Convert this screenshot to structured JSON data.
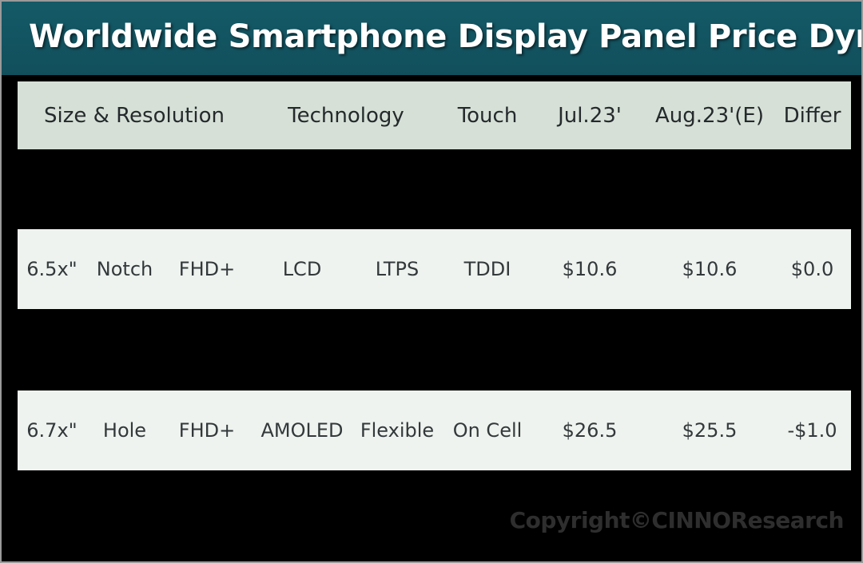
{
  "banner": {
    "title": "Worldwide Smartphone Display Panel Price Dynamic",
    "background_color": "#125562",
    "text_color": "#ffffff"
  },
  "table": {
    "header_background": "#d7e0d7",
    "row_background": "#eff3ef",
    "page_background": "#000000",
    "headers": [
      {
        "label": "Size & Resolution"
      },
      {
        "label": "Technology"
      },
      {
        "label": "Touch"
      },
      {
        "label": "Jul.23'"
      },
      {
        "label": "Aug.23'(E)"
      },
      {
        "label": "Differ"
      }
    ],
    "rows": [
      {
        "size": "6.5x\"",
        "cutout": "Notch",
        "resolution": "FHD+",
        "technology": "LCD",
        "backplane": "LTPS",
        "touch": "TDDI",
        "jul23": "$10.6",
        "aug23e": "$10.6",
        "differ": "$0.0"
      },
      {
        "size": "6.7x\"",
        "cutout": "Hole",
        "resolution": "FHD+",
        "technology": "AMOLED",
        "backplane": "Flexible",
        "touch": "On Cell",
        "jul23": "$26.5",
        "aug23e": "$25.5",
        "differ": "-$1.0"
      }
    ]
  },
  "watermark": {
    "text": "Copyright©CINNOResearch"
  }
}
